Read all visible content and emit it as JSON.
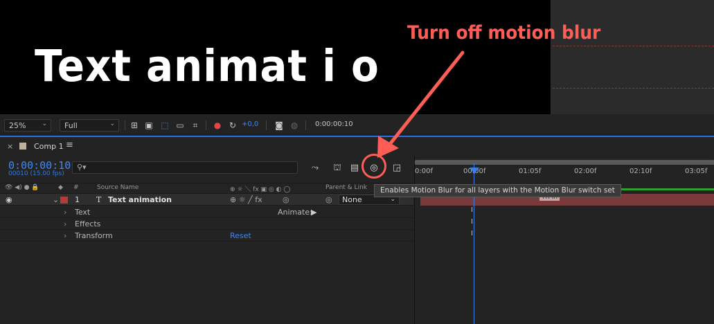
{
  "annotation": {
    "title": "Turn off motion blur",
    "color": "#ff5e57"
  },
  "canvas": {
    "preview_text": "Text animat i o"
  },
  "viewer_toolbar": {
    "zoom": "25%",
    "resolution": "Full",
    "exposure": "+0,0",
    "timecode": "0:00:00:10",
    "icons": [
      "grid-icon",
      "mask-icon",
      "region-icon",
      "transparency-icon",
      "3d-view-icon",
      "channel-icon",
      "reset-exposure-icon",
      "snapshot-icon",
      "show-snapshot-icon"
    ]
  },
  "timeline": {
    "tab": {
      "close": "×",
      "label": "Comp 1",
      "menu": "≡"
    },
    "current_time": "0:00:00:10",
    "frame_info": "00010 (15.00 fps)",
    "search_placeholder": "",
    "columns": {
      "source_name": "Source Name",
      "parent_link": "Parent & Link",
      "number": "#"
    },
    "layer": {
      "number": "1",
      "type_glyph": "T",
      "name": "Text animation",
      "parent": "None"
    },
    "properties": [
      {
        "label": "Text",
        "action": "Animate:"
      },
      {
        "label": "Effects",
        "action": ""
      },
      {
        "label": "Transform",
        "action": "Reset"
      }
    ],
    "ruler": [
      "0:00f",
      "00:00f",
      "01:05f",
      "02:00f",
      "02:10f",
      "03:05f"
    ],
    "layer_bar_label": "TR In",
    "tooltip": "Enables Motion Blur for all layers with the Motion Blur switch set",
    "accent_color": "#3b7fe8",
    "layer_color": "#b23b3b"
  }
}
